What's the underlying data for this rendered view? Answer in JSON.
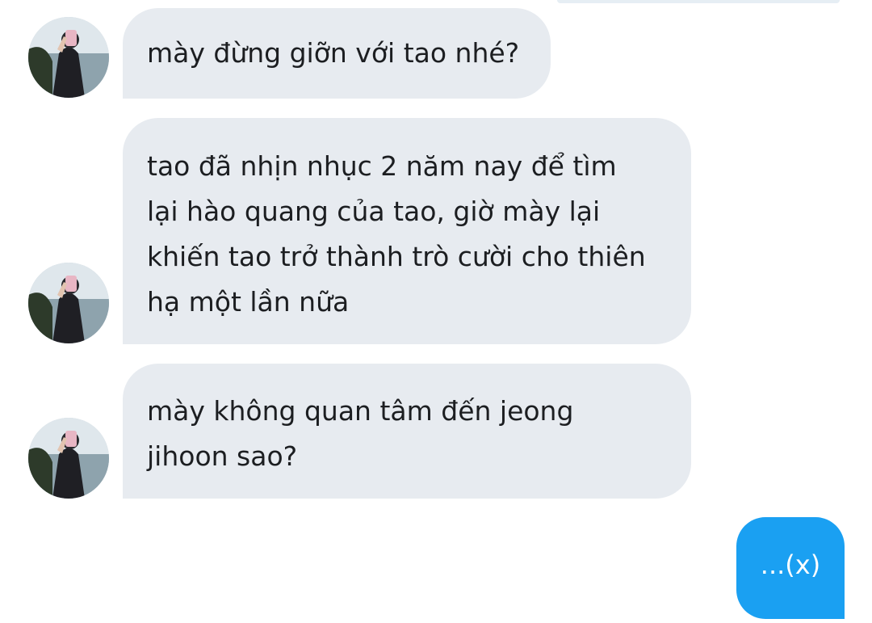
{
  "conversation": {
    "incoming": [
      {
        "lines": [
          "mày đừng giỡn với tao nhé?"
        ]
      },
      {
        "lines": [
          "tao đã nhịn nhục 2 năm nay để tìm",
          "lại hào quang của tao, giờ mày lại",
          "khiến tao trở thành trò cười cho thiên",
          "hạ một lần nữa"
        ]
      },
      {
        "lines": [
          "mày không quan tâm đến jeong",
          "jihoon sao?"
        ]
      }
    ],
    "outgoing": [
      {
        "text": "...(x)"
      }
    ]
  },
  "colors": {
    "incoming_bubble": "#e7ebf0",
    "outgoing_bubble": "#1aa0f2",
    "text_dark": "#1c1e21",
    "text_light": "#ffffff"
  }
}
